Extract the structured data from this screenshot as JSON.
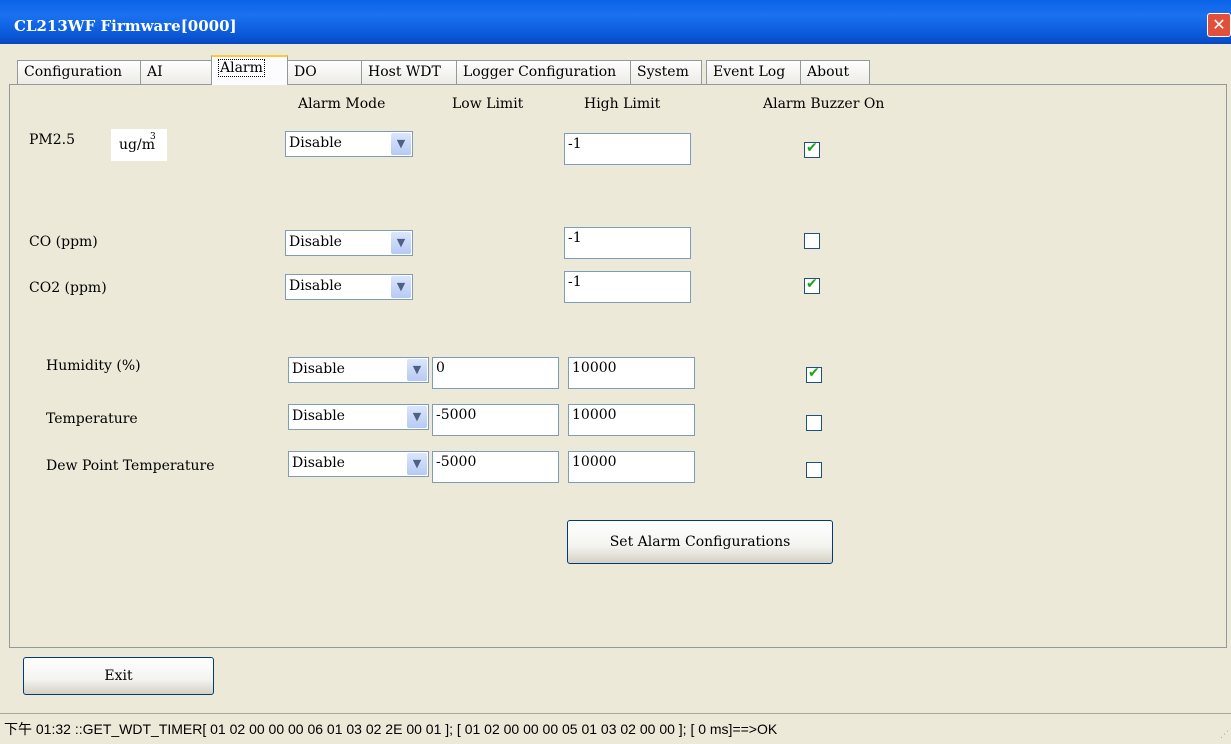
{
  "window": {
    "title": "CL213WF Firmware[0000]",
    "close_glyph": "✕"
  },
  "tabs": [
    "Configuration",
    "AI",
    "Alarm",
    "DO",
    "Host WDT",
    "Logger Configuration",
    "System",
    "Event Log",
    "About"
  ],
  "active_tab": "Alarm",
  "headers": {
    "alarm_mode": "Alarm Mode",
    "low_limit": "Low Limit",
    "high_limit": "High Limit",
    "buzzer": "Alarm Buzzer On"
  },
  "unit_image": {
    "base": "ug/m",
    "sup": "3"
  },
  "rows": [
    {
      "label": "PM2.5",
      "mode": "Disable",
      "low": null,
      "high": "-1",
      "buzzer": true
    },
    {
      "label": "CO (ppm)",
      "mode": "Disable",
      "low": null,
      "high": "-1",
      "buzzer": false
    },
    {
      "label": "CO2 (ppm)",
      "mode": "Disable",
      "low": null,
      "high": "-1",
      "buzzer": true
    },
    {
      "label": "Humidity (%)",
      "mode": "Disable",
      "low": "0",
      "high": "10000",
      "buzzer": true
    },
    {
      "label": "Temperature",
      "mode": "Disable",
      "low": "-5000",
      "high": "10000",
      "buzzer": false
    },
    {
      "label": "Dew Point Temperature",
      "mode": "Disable",
      "low": "-5000",
      "high": "10000",
      "buzzer": false
    }
  ],
  "buttons": {
    "set_alarm": "Set Alarm Configurations",
    "exit": "Exit"
  },
  "status_text": "下午 01:32 ::GET_WDT_TIMER[ 01 02 00 00 00 06 01 03 02 2E 00 01  ]; [ 01 02 00 00 00 05 01 03 02 00 00  ]; [ 0 ms]==>OK",
  "icons": {
    "dropdown": "chevron-down-icon",
    "check": "✔"
  },
  "colors": {
    "titlebar": "#0A5FE0",
    "face": "#ECE9D8",
    "close": "#E0503A",
    "active_tab_highlight": "#FFC83C",
    "checkmark": "#21A121"
  }
}
